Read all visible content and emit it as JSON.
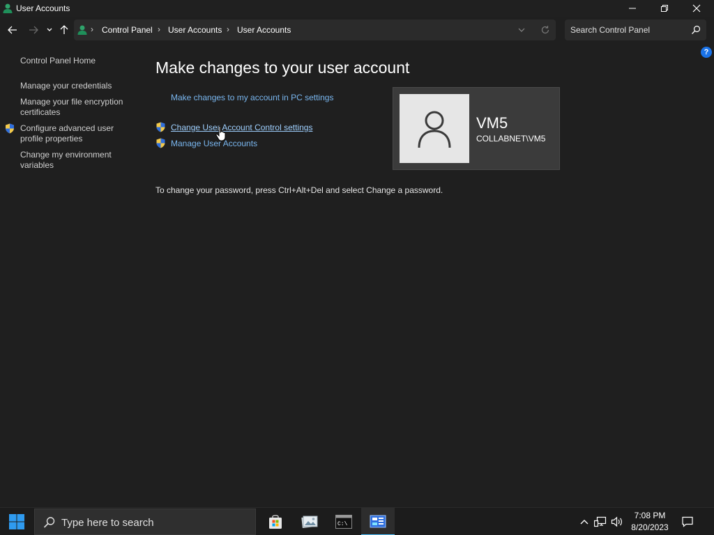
{
  "window": {
    "title": "User Accounts"
  },
  "navbar": {
    "breadcrumbs": [
      "Control Panel",
      "User Accounts",
      "User Accounts"
    ],
    "search_placeholder": "Search Control Panel",
    "help_label": "?"
  },
  "sidebar": {
    "home": "Control Panel Home",
    "items": [
      {
        "label": "Manage your credentials",
        "icon": ""
      },
      {
        "label": "Manage your file encryption certificates",
        "icon": ""
      },
      {
        "label": "Configure advanced user profile properties",
        "icon": "uac-shield-icon"
      },
      {
        "label": "Change my environment variables",
        "icon": ""
      }
    ]
  },
  "main": {
    "title": "Make changes to your user account",
    "links": [
      {
        "label": "Make changes to my account in PC settings",
        "icon": ""
      },
      {
        "label": "Change User Account Control settings",
        "icon": "uac-shield-icon"
      },
      {
        "label": "Manage User Accounts",
        "icon": "uac-shield-icon"
      }
    ],
    "password_note": "To change your password, press Ctrl+Alt+Del and select Change a password."
  },
  "user": {
    "name": "VM5",
    "domain": "COLLABNET\\VM5"
  },
  "taskbar": {
    "search_placeholder": "Type here to search",
    "apps": [
      "microsoft-store-icon",
      "photo-viewer-icon",
      "command-prompt-icon",
      "control-panel-icon"
    ],
    "active_app": "control-panel-icon",
    "time": "7:08 PM",
    "date": "8/20/2023"
  },
  "colors": {
    "background": "#1f1f1f",
    "link": "#7ab7f0",
    "accent": "#4cc2ff"
  }
}
